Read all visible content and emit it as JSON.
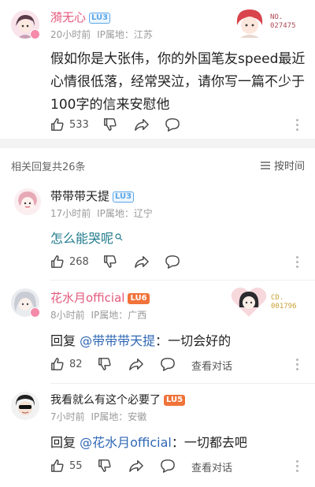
{
  "post": {
    "author": "漪无心",
    "level": "LU3",
    "time": "20小时前",
    "ip_label": "IP属地：",
    "ip_location": "江苏",
    "badge_label": "NO.",
    "badge_number": "027475",
    "content_line1": "假如你是大张伟，你的外国笔友speed最近",
    "content_line2": "心情很低落，经常哭泣，请你写一篇不少于",
    "content_line3": "100字的信来安慰他",
    "likes": "533"
  },
  "replies_header": {
    "count_label": "相关回复共26条",
    "sort_label": "按时间"
  },
  "replies": [
    {
      "author": "带带带天提",
      "level": "LU3",
      "time": "17小时前",
      "ip_label": "IP属地：",
      "ip_location": "辽宁",
      "content": "怎么能哭呢",
      "likes": "268"
    },
    {
      "author": "花水月official",
      "level": "LU6",
      "time": "8小时前",
      "ip_label": "IP属地：",
      "ip_location": "广西",
      "reply_prefix": "回复 ",
      "mention": "@带带带天提",
      "content": "：一切会好的",
      "likes": "82",
      "view_thread": "查看对话",
      "badge_label": "CD.",
      "badge_number": "001796"
    },
    {
      "author": "我看就么有这个必要了",
      "level": "LU5",
      "time": "7小时前",
      "ip_label": "IP属地：",
      "ip_location": "安徽",
      "reply_prefix": "回复 ",
      "mention": "@花水月official",
      "content": "：一切都去吧",
      "likes": "55",
      "view_thread": "查看对话"
    }
  ],
  "icons": {
    "like": "thumbs-up-icon",
    "dislike": "thumbs-down-icon",
    "share": "share-icon",
    "comment": "comment-icon",
    "more": "more-vertical-icon",
    "sort": "sort-lines-icon",
    "search": "search-icon"
  },
  "colors": {
    "mention": "#2f67b5",
    "level_blue": "#5aa7e8",
    "level_orange": "#f0733a",
    "meta_gray": "#9a9a9a"
  }
}
